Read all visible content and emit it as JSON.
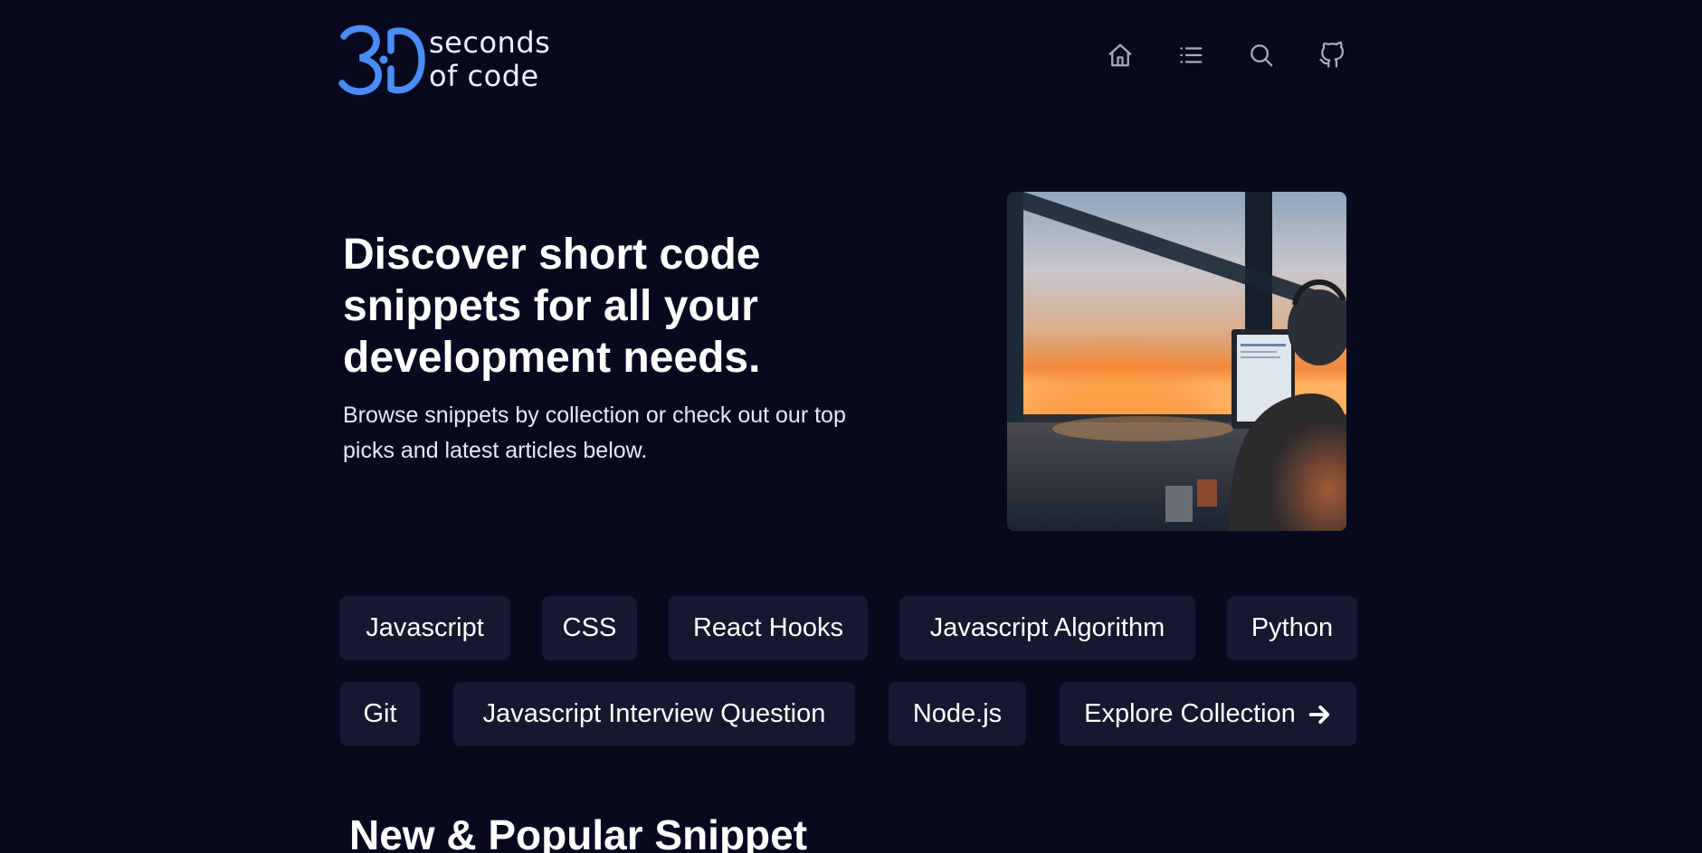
{
  "brand": {
    "logo_line1": "seconds",
    "logo_line2": "of code",
    "accent_color": "#4a8cf7"
  },
  "nav": {
    "items": [
      {
        "icon": "home-icon"
      },
      {
        "icon": "list-icon"
      },
      {
        "icon": "search-icon"
      },
      {
        "icon": "github-icon"
      }
    ]
  },
  "hero": {
    "title": "Discover short code snippets for all your development needs.",
    "subtitle": "Browse snippets by collection or check out our top picks and latest articles below."
  },
  "collections": [
    {
      "label": "Javascript"
    },
    {
      "label": "CSS"
    },
    {
      "label": "React Hooks"
    },
    {
      "label": "Javascript Algorithm"
    },
    {
      "label": "Python"
    },
    {
      "label": "Git"
    },
    {
      "label": "Javascript Interview Question"
    },
    {
      "label": "Node.js"
    },
    {
      "label": "Explore Collection",
      "icon": "arrow-right-icon"
    }
  ],
  "sections": {
    "new_popular_title": "New & Popular Snippet"
  },
  "colors": {
    "background": "#070a1e",
    "chip_background": "#15182f",
    "nav_icon": "#a9acbf"
  }
}
